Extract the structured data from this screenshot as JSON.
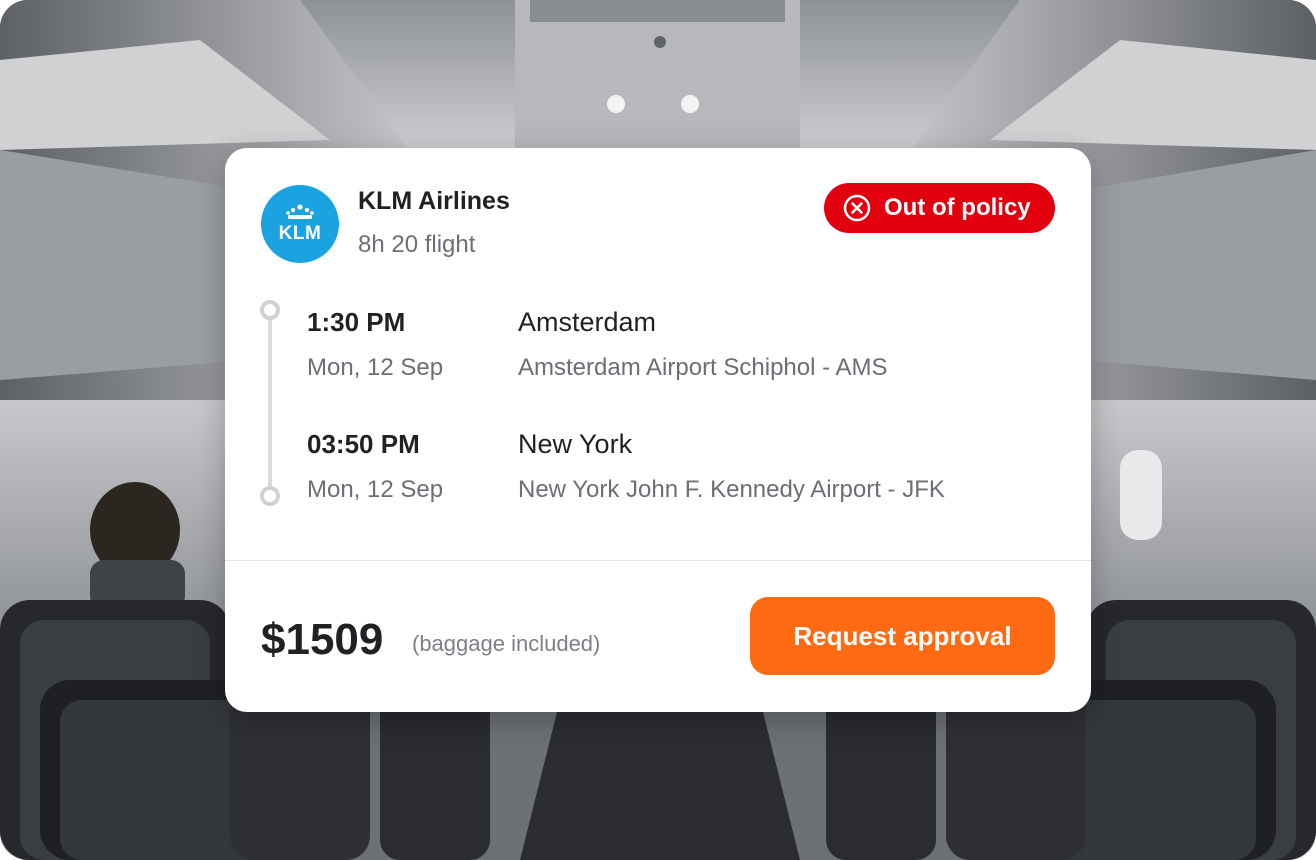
{
  "flight": {
    "airline_name": "KLM Airlines",
    "duration": "8h 20 flight",
    "logo_text": "KLM",
    "policy_status": "Out of policy"
  },
  "departure": {
    "time": "1:30 PM",
    "date": "Mon, 12 Sep",
    "city": "Amsterdam",
    "airport": "Amsterdam Airport Schiphol - AMS"
  },
  "arrival": {
    "time": "03:50 PM",
    "date": "Mon, 12 Sep",
    "city": "New York",
    "airport": "New York John F. Kennedy Airport - JFK"
  },
  "pricing": {
    "price": "$1509",
    "note": "(baggage included)"
  },
  "actions": {
    "request_label": "Request approval"
  },
  "icons": {
    "logo": "klm-crown-logo",
    "policy": "close-circle-icon"
  },
  "colors": {
    "brand_blue": "#1aa3e0",
    "policy_red": "#e2000f",
    "accent_orange": "#ff6a13"
  }
}
